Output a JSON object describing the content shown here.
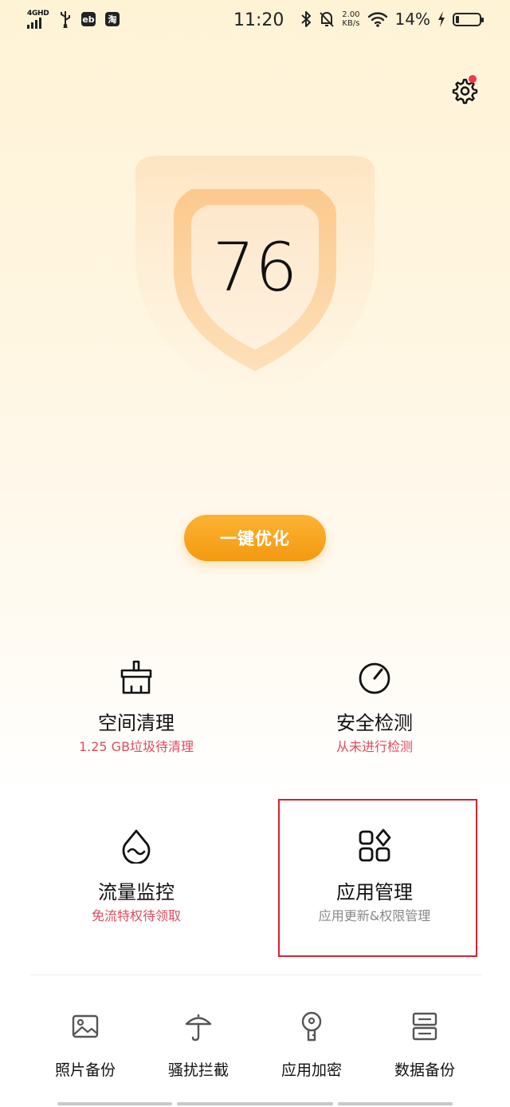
{
  "status": {
    "network": "4GHD",
    "app1": "eb",
    "app2": "淘",
    "time": "11:20",
    "speed_value": "2.00",
    "speed_unit": "KB/s",
    "battery": "14%"
  },
  "score": "76",
  "optimize_label": "一键优化",
  "features": [
    {
      "title": "空间清理",
      "subtitle": "1.25 GB垃圾待清理",
      "icon": "broom-icon"
    },
    {
      "title": "安全检测",
      "subtitle": "从未进行检测",
      "icon": "gauge-icon"
    },
    {
      "title": "流量监控",
      "subtitle": "免流特权待领取",
      "icon": "water-drop-icon"
    },
    {
      "title": "应用管理",
      "subtitle": "应用更新&权限管理",
      "icon": "apps-grid-icon"
    }
  ],
  "bottom": [
    {
      "label": "照片备份",
      "icon": "photo-icon"
    },
    {
      "label": "骚扰拦截",
      "icon": "umbrella-icon"
    },
    {
      "label": "应用加密",
      "icon": "key-lock-icon"
    },
    {
      "label": "数据备份",
      "icon": "database-icon"
    }
  ],
  "colors": {
    "accent": "#f5a01a",
    "alert": "#e04b5f",
    "notification_dot": "#f0394a"
  }
}
